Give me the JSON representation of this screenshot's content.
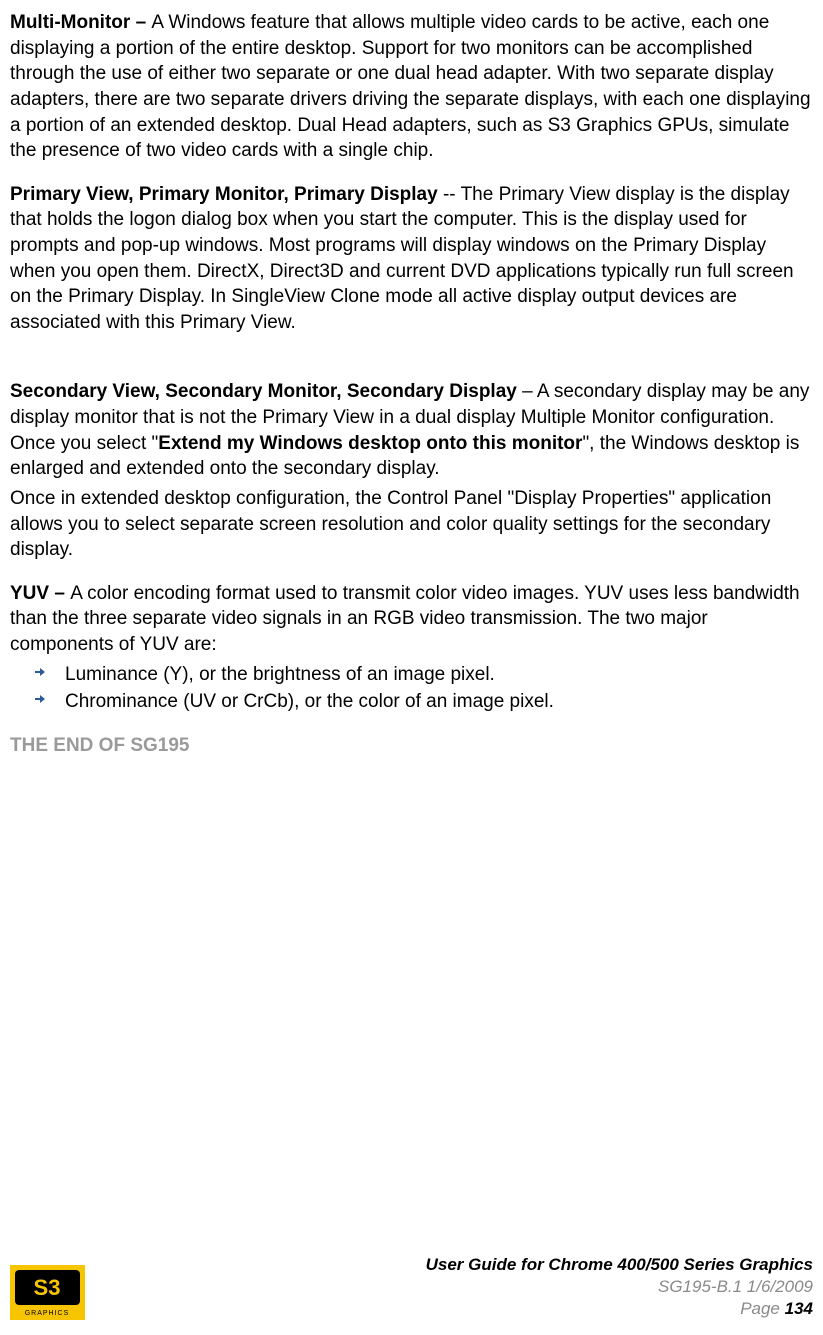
{
  "entries": {
    "multi_monitor": {
      "term": "Multi-Monitor – ",
      "body": "A Windows feature that allows multiple video cards to be active, each one displaying a portion of the entire desktop. Support for two monitors can be accomplished through the use of either two separate or one dual head adapter. With two separate display adapters, there are two separate drivers driving the separate displays, with each one displaying a portion of an extended desktop. Dual Head adapters, such as S3 Graphics GPUs, simulate the presence of two video cards with a single chip."
    },
    "primary_view": {
      "term": "Primary View, Primary Monitor, Primary Display",
      "sep": " -- ",
      "body": "The Primary View display is the display that holds the logon dialog box when you start the computer. This is the display used for prompts and pop-up windows. Most programs will display windows on the Primary Display when you open them. DirectX, Direct3D and current DVD applications typically run full screen on the Primary Display. In SingleView Clone mode all active display output devices are associated with this Primary View."
    },
    "secondary_view": {
      "term": "Secondary View, Secondary Monitor, Secondary Display",
      "sep": " – ",
      "body_before": "A secondary display may be any display monitor that is not the Primary View in a dual display Multiple Monitor configuration. Once you select \"",
      "bold_inline": "Extend my Windows desktop onto this monitor",
      "body_after": "\", the Windows desktop is enlarged and extended onto the secondary display.",
      "para2": "Once in extended desktop configuration, the Control Panel \"Display Properties\" application allows you to select separate screen resolution and color quality settings for the secondary display."
    },
    "yuv": {
      "term": "YUV – ",
      "body": "A color encoding format used to transmit color video images. YUV uses less bandwidth than the three separate video signals in an RGB video transmission. The two major components of YUV are:",
      "bullets": [
        "Luminance (Y), or the brightness of an image pixel.",
        "Chrominance (UV or CrCb), or the color of an image pixel."
      ]
    }
  },
  "end_text": "THE END OF SG195",
  "footer": {
    "title": "User Guide for Chrome 400/500 Series Graphics",
    "sub": "SG195-B.1   1/6/2009",
    "page_label": "Page ",
    "page_num": "134"
  }
}
